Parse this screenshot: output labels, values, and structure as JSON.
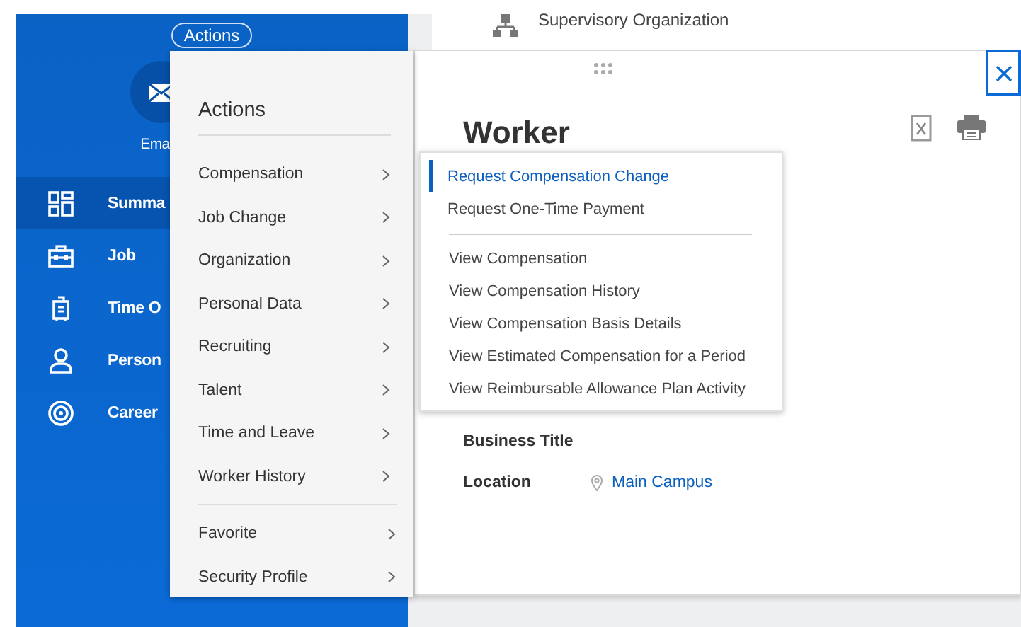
{
  "sidebar": {
    "actions_button": "Actions",
    "email_label": "Ema",
    "nav_items": [
      {
        "label": "Summa",
        "selected": true
      },
      {
        "label": "Job",
        "selected": false
      },
      {
        "label": "Time O",
        "selected": false
      },
      {
        "label": "Person",
        "selected": false
      },
      {
        "label": "Career",
        "selected": false
      }
    ]
  },
  "background_card": {
    "label": "Supervisory Organization"
  },
  "worker_panel": {
    "title": "Worker",
    "fields": [
      {
        "label": "Business Title"
      },
      {
        "label": "Location",
        "value": "Main Campus"
      }
    ]
  },
  "actions_menu": {
    "title": "Actions",
    "groups": [
      [
        "Compensation",
        "Job Change",
        "Organization",
        "Personal Data",
        "Recruiting",
        "Talent",
        "Time and Leave",
        "Worker History"
      ],
      [
        "Favorite",
        "Security Profile"
      ]
    ]
  },
  "submenu": {
    "groups": [
      [
        {
          "label": "Request Compensation Change",
          "selected": true
        },
        {
          "label": "Request One-Time Payment",
          "selected": false
        }
      ],
      [
        {
          "label": "View Compensation",
          "selected": false
        },
        {
          "label": "View Compensation History",
          "selected": false
        },
        {
          "label": "View Compensation Basis Details",
          "selected": false
        },
        {
          "label": "View Estimated Compensation for a Period",
          "selected": false
        },
        {
          "label": "View Reimbursable Allowance Plan Activity",
          "selected": false
        }
      ]
    ]
  }
}
